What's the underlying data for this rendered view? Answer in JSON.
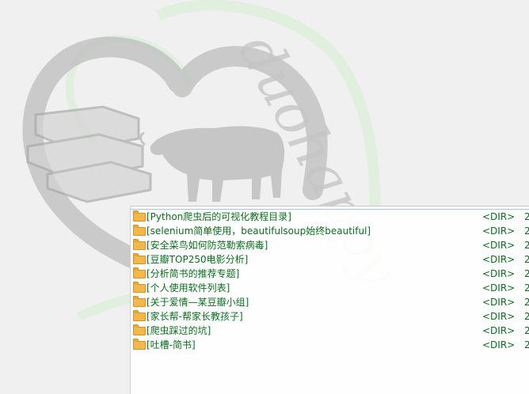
{
  "watermark": {
    "brand_text": "duohappy"
  },
  "listing": {
    "rows": [
      {
        "name": "[Python爬虫后的可视化教程目录]",
        "type": "<DIR>",
        "date": "2"
      },
      {
        "name": "[selenium简单使用，beautifulsoup始终beautiful]",
        "type": "<DIR>",
        "date": "2"
      },
      {
        "name": "[安全菜鸟如何防范勒索病毒]",
        "type": "<DIR>",
        "date": "2"
      },
      {
        "name": "[豆瓣TOP250电影分析]",
        "type": "<DIR>",
        "date": "2"
      },
      {
        "name": "[分析简书的推荐专题]",
        "type": "<DIR>",
        "date": "2"
      },
      {
        "name": "[个人使用软件列表]",
        "type": "<DIR>",
        "date": "2"
      },
      {
        "name": "[关于爱情—某豆瓣小组]",
        "type": "<DIR>",
        "date": "2"
      },
      {
        "name": "[家长帮-帮家长教孩子]",
        "type": "<DIR>",
        "date": "2"
      },
      {
        "name": "[爬虫踩过的坑]",
        "type": "<DIR>",
        "date": "2"
      },
      {
        "name": "[吐槽-简书]",
        "type": "<DIR>",
        "date": "2"
      }
    ]
  },
  "colors": {
    "link_text": "#0a6e1e",
    "folder": "#f3b84c",
    "watermark_gray": "#bdbdbd",
    "watermark_green": "#d9ecd6"
  }
}
